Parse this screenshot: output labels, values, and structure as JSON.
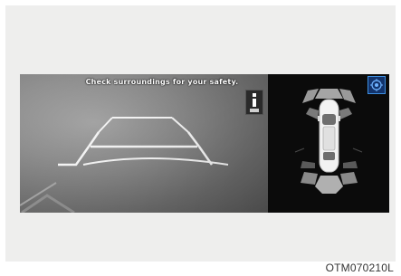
{
  "camera": {
    "warning_text": "Check surroundings for your safety."
  },
  "icons": {
    "sensor": "parking-sensor-icon",
    "view_mode": "view-mode-icon",
    "car": "car-top-view-icon"
  },
  "colors": {
    "screen_bg": "#000000",
    "guideline": "#ffffff",
    "sensor_zone": "#a5a5a5",
    "badge": "#12336b"
  },
  "caption": {
    "code": "OTM070210L"
  }
}
